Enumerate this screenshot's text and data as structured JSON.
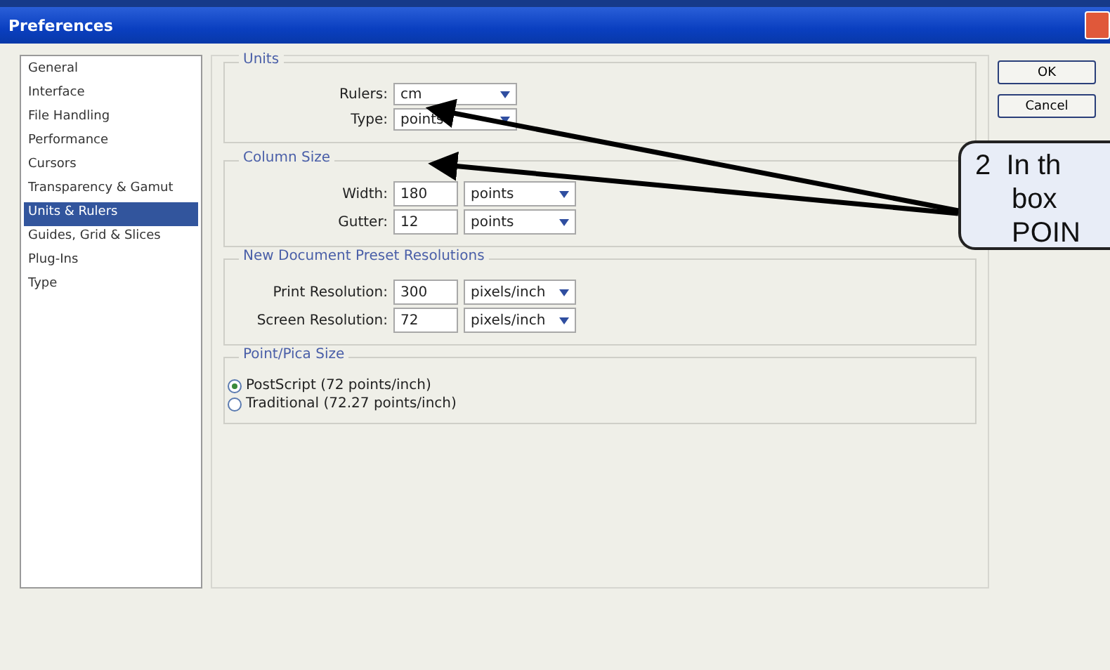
{
  "window": {
    "title": "Preferences"
  },
  "sidebar": {
    "items": [
      {
        "label": "General",
        "selected": false
      },
      {
        "label": "Interface",
        "selected": false
      },
      {
        "label": "File Handling",
        "selected": false
      },
      {
        "label": "Performance",
        "selected": false
      },
      {
        "label": "Cursors",
        "selected": false
      },
      {
        "label": "Transparency & Gamut",
        "selected": false
      },
      {
        "label": "Units & Rulers",
        "selected": true
      },
      {
        "label": "Guides, Grid & Slices",
        "selected": false
      },
      {
        "label": "Plug-Ins",
        "selected": false
      },
      {
        "label": "Type",
        "selected": false
      }
    ]
  },
  "groups": [
    {
      "kind": "dropdowns",
      "title": "Units",
      "fields": [
        {
          "label": "Rulers:",
          "value": "cm"
        },
        {
          "label": "Type:",
          "value": "points"
        }
      ]
    },
    {
      "kind": "numbers",
      "title": "Column Size",
      "fields": [
        {
          "label": "Width:",
          "value": "180",
          "unit": "points"
        },
        {
          "label": "Gutter:",
          "value": "12",
          "unit": "points"
        }
      ]
    },
    {
      "kind": "numbers",
      "title": "New Document Preset Resolutions",
      "fields": [
        {
          "label": "Print Resolution:",
          "value": "300",
          "unit": "pixels/inch"
        },
        {
          "label": "Screen Resolution:",
          "value": "72",
          "unit": "pixels/inch"
        }
      ]
    },
    {
      "kind": "radios",
      "title": "Point/Pica Size",
      "options": [
        {
          "label": "PostScript (72 points/inch)",
          "selected": true
        },
        {
          "label": "Traditional (72.27 points/inch)",
          "selected": false
        }
      ]
    }
  ],
  "buttons": [
    "OK",
    "Cancel"
  ],
  "callout": {
    "lines": [
      "2  In th",
      "box",
      "POIN"
    ]
  }
}
